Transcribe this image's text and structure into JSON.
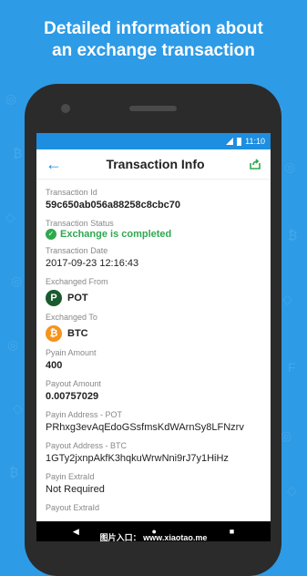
{
  "headline": {
    "line1": "Detailed information about",
    "line2": "an exchange transaction"
  },
  "status_bar": {
    "time": "11:10",
    "icons": [
      "signal-icon",
      "battery-icon"
    ]
  },
  "app_bar": {
    "title": "Transaction Info",
    "back_icon": "arrow-left-icon",
    "share_icon": "share-icon",
    "accent": "#1d8ee0",
    "share_color": "#2fa84f"
  },
  "fields": {
    "transaction_id": {
      "label": "Transaction Id",
      "value": "59c650ab056a88258c8cbc70"
    },
    "transaction_status": {
      "label": "Transaction Status",
      "value": "Exchange is completed",
      "color": "#2fa84f"
    },
    "transaction_date": {
      "label": "Transaction Date",
      "value": "2017-09-23 12:16:43"
    },
    "exchanged_from": {
      "label": "Exchanged From",
      "value": "POT",
      "icon_letter": "P",
      "icon_color": "#1a5a2e"
    },
    "exchanged_to": {
      "label": "Exchanged To",
      "value": "BTC",
      "icon_letter": "₿",
      "icon_color": "#f7931a"
    },
    "pyain_amount": {
      "label": "Pyain Amount",
      "value": "400"
    },
    "payout_amount": {
      "label": "Payout Amount",
      "value": "0.00757029"
    },
    "payin_address": {
      "label": "Payin Address - POT",
      "value": "PRhxg3evAqEdoGSsfmsKdWArnSy8LFNzrv"
    },
    "payout_address": {
      "label": "Payout Address - BTC",
      "value": "1GTy2jxnpAkfK3hqkuWrwNni9rJ7y1HiHz"
    },
    "payin_extraid": {
      "label": "Payin ExtraId",
      "value": "Not Required"
    },
    "payout_extraid": {
      "label": "Payout ExtraId",
      "value": ""
    }
  },
  "watermark": "图片入口： www.xiaotao.me"
}
